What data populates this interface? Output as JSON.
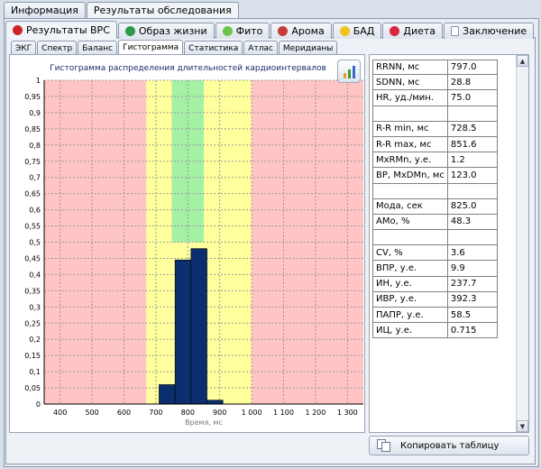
{
  "tabs_top": [
    {
      "label": "Информация",
      "active": false
    },
    {
      "label": "Результаты обследования",
      "active": true
    }
  ],
  "tabs_main": [
    {
      "label": "Результаты ВРС",
      "icon": "heart-icon",
      "color": "#d0202a",
      "active": true
    },
    {
      "label": "Образ жизни",
      "icon": "globe-icon",
      "color": "#2a9a4a",
      "active": false
    },
    {
      "label": "Фито",
      "icon": "flower-icon",
      "color": "#6cc24a",
      "active": false
    },
    {
      "label": "Арома",
      "icon": "rose-icon",
      "color": "#c83a3a",
      "active": false
    },
    {
      "label": "БАД",
      "icon": "sun-icon",
      "color": "#f2c21c",
      "active": false
    },
    {
      "label": "Диета",
      "icon": "strawberry-icon",
      "color": "#d8283a",
      "active": false
    },
    {
      "label": "Заключение",
      "icon": "document-icon",
      "color": "#ffffff",
      "active": false
    }
  ],
  "tabs_sub": [
    {
      "label": "ЭКГ",
      "active": false
    },
    {
      "label": "Спектр",
      "active": false
    },
    {
      "label": "Баланс",
      "active": false
    },
    {
      "label": "Гистограмма",
      "active": true
    },
    {
      "label": "Статистика",
      "active": false
    },
    {
      "label": "Атлас",
      "active": false
    },
    {
      "label": "Меридианы",
      "active": false
    }
  ],
  "chart_data": {
    "type": "bar",
    "title": "Гистограмма распределения длительностей кардиоинтервалов",
    "xlabel": "Время, мс",
    "ylabel": "",
    "xlim": [
      350,
      1350
    ],
    "ylim": [
      0,
      1
    ],
    "grid": true,
    "x_ticks": [
      400,
      500,
      600,
      700,
      800,
      900,
      1000,
      1100,
      1200,
      1300
    ],
    "x_tick_labels": [
      "400",
      "500",
      "600",
      "700",
      "800",
      "900",
      "1 000",
      "1 100",
      "1 200",
      "1 300"
    ],
    "y_ticks": [
      0,
      0.05,
      0.1,
      0.15,
      0.2,
      0.25,
      0.3,
      0.35,
      0.4,
      0.45,
      0.5,
      0.55,
      0.6,
      0.65,
      0.7,
      0.75,
      0.8,
      0.85,
      0.9,
      0.95,
      1
    ],
    "y_tick_labels": [
      "0",
      "0,05",
      "0,1",
      "0,15",
      "0,2",
      "0,25",
      "0,3",
      "0,35",
      "0,4",
      "0,45",
      "0,5",
      "0,55",
      "0,6",
      "0,65",
      "0,7",
      "0,75",
      "0,8",
      "0,85",
      "0,9",
      "0,95",
      "1"
    ],
    "zones": [
      {
        "from": 350,
        "to": 670,
        "color": "#ffc4c4"
      },
      {
        "from": 670,
        "to": 710,
        "color": "#ffff9e"
      },
      {
        "from": 710,
        "to": 850,
        "color": "#ffff9e"
      },
      {
        "from": 850,
        "to": 1000,
        "color": "#ffff9e"
      },
      {
        "from": 1000,
        "to": 1350,
        "color": "#ffc4c4"
      }
    ],
    "green_zone": {
      "from": 750,
      "to": 850,
      "y_from": 0.5,
      "y_to": 1,
      "color": "#a4f0a4"
    },
    "bars": [
      {
        "x0": 710,
        "x1": 760,
        "value": 0.06
      },
      {
        "x0": 760,
        "x1": 810,
        "value": 0.445
      },
      {
        "x0": 810,
        "x1": 860,
        "value": 0.48
      },
      {
        "x0": 860,
        "x1": 910,
        "value": 0.012
      }
    ],
    "bar_color": "#0b2e6e"
  },
  "params": [
    {
      "name": "RRNN, мс",
      "value": "797.0"
    },
    {
      "name": "SDNN, мс",
      "value": "28.8"
    },
    {
      "name": "HR, уд./мин.",
      "value": "75.0"
    },
    {
      "name": "",
      "value": ""
    },
    {
      "name": "R-R min, мс",
      "value": "728.5"
    },
    {
      "name": "R-R max, мс",
      "value": "851.6"
    },
    {
      "name": "MxRMn, у.е.",
      "value": "1.2"
    },
    {
      "name": "ВР, MxDMn, мс",
      "value": "123.0"
    },
    {
      "name": "",
      "value": ""
    },
    {
      "name": "Мода, сек",
      "value": "825.0"
    },
    {
      "name": "АМо, %",
      "value": "48.3"
    },
    {
      "name": "",
      "value": ""
    },
    {
      "name": "CV, %",
      "value": "3.6"
    },
    {
      "name": "ВПР, у.е.",
      "value": "9.9"
    },
    {
      "name": "ИН, у.е.",
      "value": "237.7"
    },
    {
      "name": "ИВР, у.е.",
      "value": "392.3"
    },
    {
      "name": "ПАПР, у.е.",
      "value": "58.5"
    },
    {
      "name": "ИЦ, у.е.",
      "value": "0.715"
    }
  ],
  "copy_button_label": "Копировать таблицу"
}
